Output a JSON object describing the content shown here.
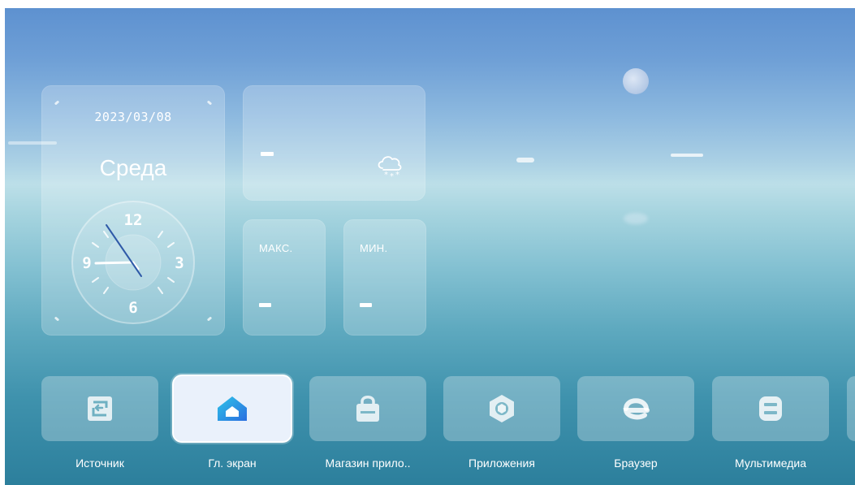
{
  "clock_widget": {
    "date": "2023/03/08",
    "weekday": "Среда",
    "numerals": {
      "n12": "12",
      "n3": "3",
      "n6": "6",
      "n9": "9"
    }
  },
  "weather_widget": {
    "current_temp": "-",
    "condition_icon": "snow-cloud-icon",
    "max_label": "МАКС.",
    "max_value": "-",
    "min_label": "МИН.",
    "min_value": "-"
  },
  "dock": {
    "apps": [
      {
        "label": "Источник",
        "icon": "input-source-icon",
        "selected": false
      },
      {
        "label": "Гл. экран",
        "icon": "home-icon",
        "selected": true
      },
      {
        "label": "Магазин прило..",
        "icon": "shopping-bag-icon",
        "selected": false
      },
      {
        "label": "Приложения",
        "icon": "apps-hexagon-icon",
        "selected": false
      },
      {
        "label": "Браузер",
        "icon": "browser-e-icon",
        "selected": false
      },
      {
        "label": "Мультимедиа",
        "icon": "multimedia-icon",
        "selected": false
      }
    ]
  },
  "colors": {
    "selected_tile": "#eaf1fb",
    "home_icon_blue": "#2b6fe0",
    "home_icon_cyan": "#2ec4e8",
    "tile_icon": "rgba(255,255,255,0.85)"
  }
}
